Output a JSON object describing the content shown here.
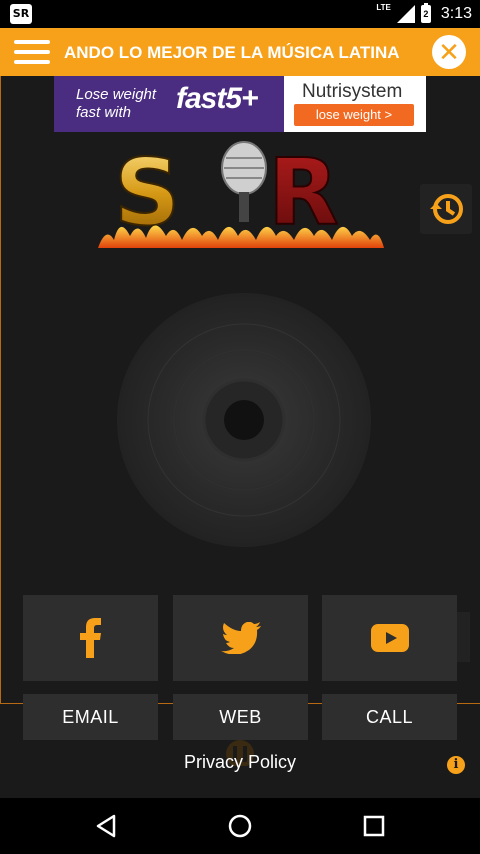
{
  "status_bar": {
    "app_icon_text": "SR",
    "network": "LTE",
    "battery_level_text": "2",
    "time": "3:13",
    "icons": [
      "app-icon",
      "signal-icon",
      "battery-icon"
    ]
  },
  "header": {
    "marquee_text": "ANDO LO MEJOR DE LA MÚSICA LATINA",
    "close_symbol": "✕",
    "accent_color": "#f7a11a"
  },
  "ad": {
    "text_line1": "Lose weight",
    "text_line2": "fast with",
    "product": "fast5+",
    "brand": "Nutrisystem",
    "cta": "lose weight >"
  },
  "logo": {
    "text": "SR"
  },
  "social": {
    "facebook_icon": "facebook-icon",
    "twitter_icon": "twitter-icon",
    "youtube_icon": "youtube-icon",
    "email_label": "EMAIL",
    "web_label": "WEB",
    "call_label": "CALL"
  },
  "footer": {
    "privacy_label": "Privacy Policy",
    "info_symbol": "i"
  },
  "colors": {
    "background": "#1a1a1a",
    "tile": "#2e2e2e",
    "accent": "#f7a11a"
  }
}
